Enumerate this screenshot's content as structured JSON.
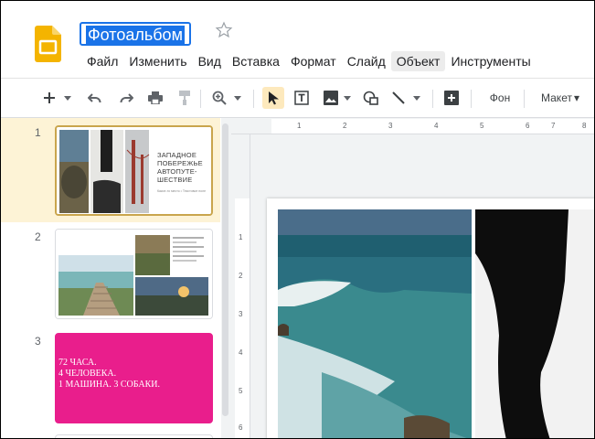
{
  "doc": {
    "title": "Фотоальбом"
  },
  "menu": [
    {
      "label": "Файл"
    },
    {
      "label": "Изменить"
    },
    {
      "label": "Вид"
    },
    {
      "label": "Вставка"
    },
    {
      "label": "Формат"
    },
    {
      "label": "Слайд"
    },
    {
      "label": "Объект"
    },
    {
      "label": "Инструменты"
    }
  ],
  "toolbar": {
    "background_label": "Фон",
    "layout_label": "Макет",
    "layout_arrow": "▾"
  },
  "ruler": {
    "h": [
      "1",
      "2",
      "3",
      "4",
      "5",
      "6",
      "7",
      "8"
    ],
    "v": [
      "1",
      "2",
      "3",
      "4",
      "5",
      "6"
    ]
  },
  "slides": [
    {
      "number": "1",
      "text": "ЗАПАДНОЕ ПОБЕРЕЖЬЕ АВТОПУТЕ-ШЕСТВИЕ",
      "subtext": "Какое-то место • Текстовое поле",
      "line1": "ЗАПАДНОЕ",
      "line2": "ПОБЕРЕЖЬЕ",
      "line3": "АВТОПУТЕ-",
      "line4": "ШЕСТВИЕ"
    },
    {
      "number": "2"
    },
    {
      "number": "3",
      "line1": "72 ЧАСА.",
      "line2": "4 ЧЕЛОВЕКА.",
      "line3": "1 МАШИНА. 3 СОБАКИ.",
      "bg": "#e91e8c"
    }
  ],
  "colors": {
    "accent": "#1a73e8",
    "slides_yellow": "#f4b400",
    "selection": "#c9a54d"
  },
  "icons": [
    "slides-logo-icon",
    "star-icon",
    "plus-icon",
    "undo-icon",
    "redo-icon",
    "print-icon",
    "paint-format-icon",
    "zoom-icon",
    "cursor-icon",
    "text-box-icon",
    "image-icon",
    "shape-icon",
    "line-icon",
    "comment-add-icon"
  ]
}
